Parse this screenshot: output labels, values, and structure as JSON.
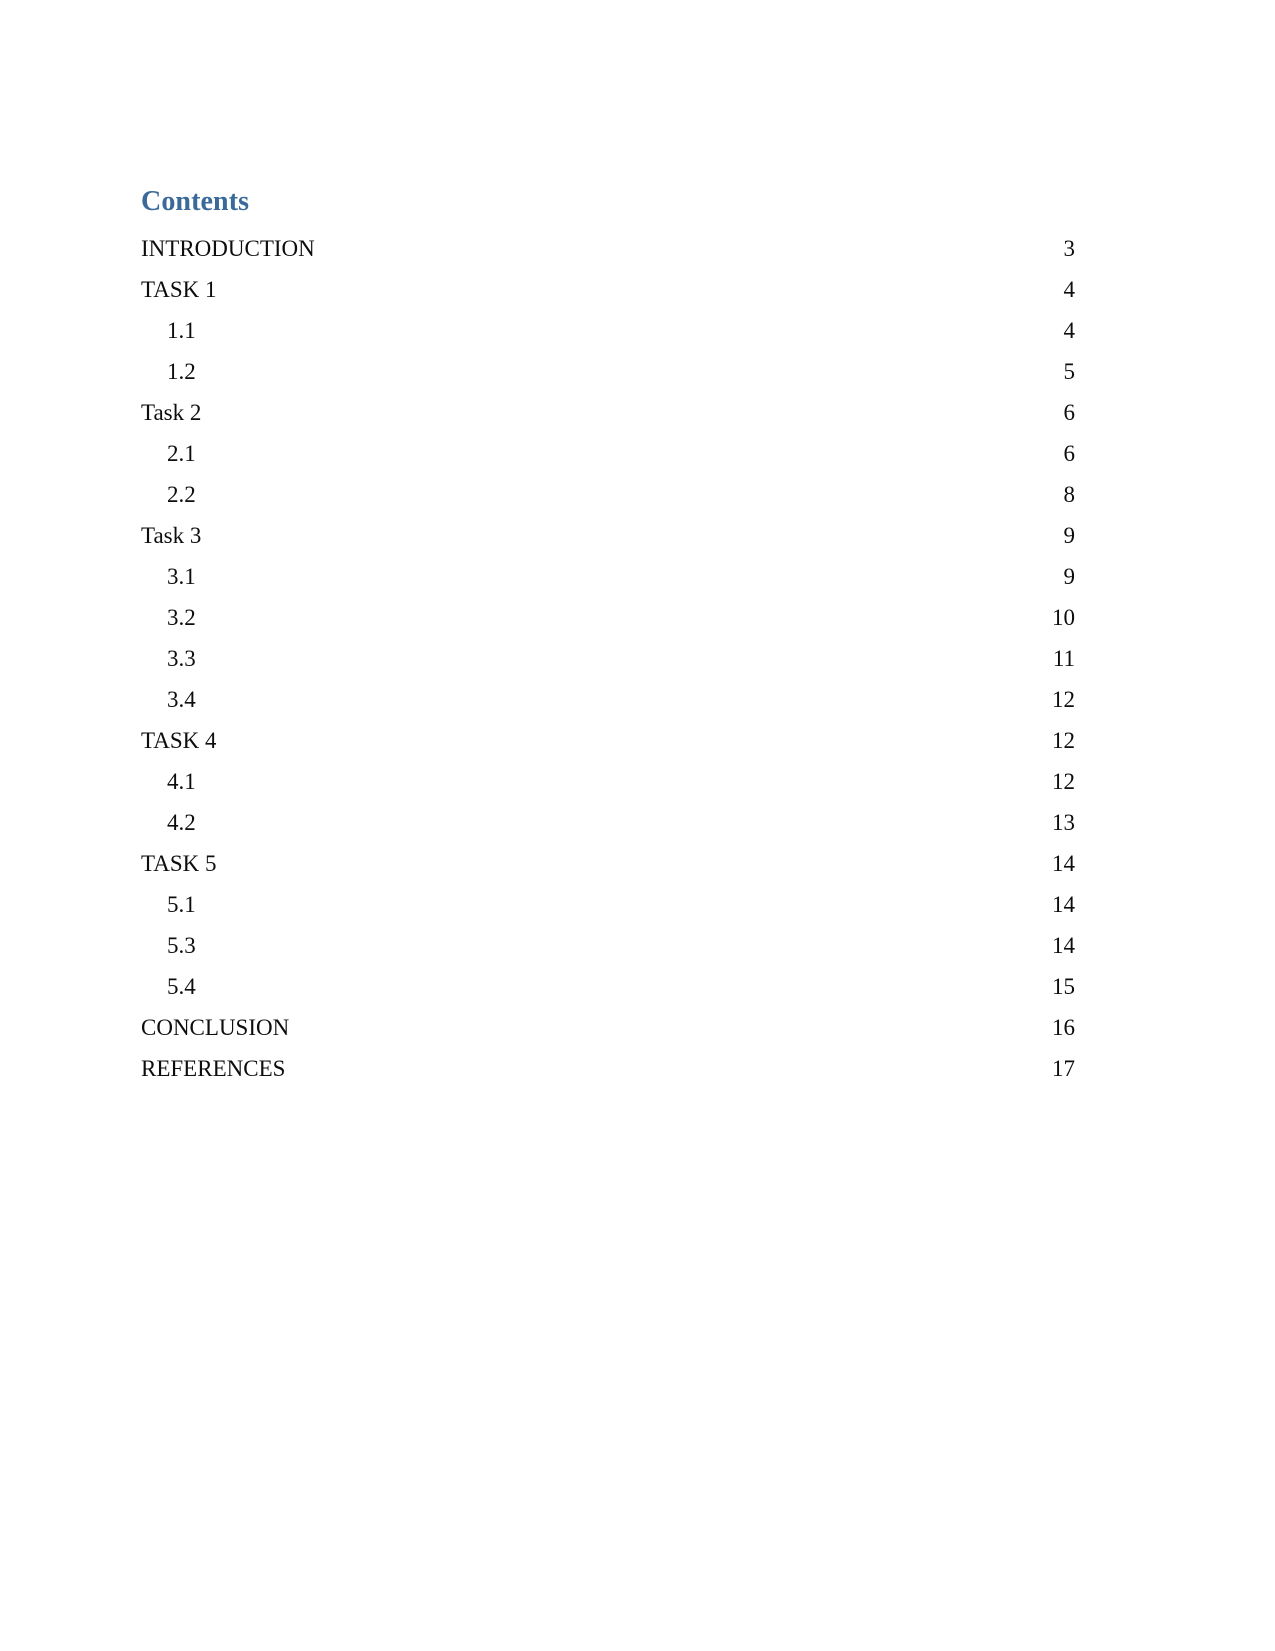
{
  "document": {
    "heading": "Contents",
    "heading_color": "#3A6A9A",
    "text_color": "#0d0d0d",
    "background_color": "#ffffff"
  },
  "toc": {
    "entries": [
      {
        "title": "INTRODUCTION",
        "page": "3",
        "level": 1
      },
      {
        "title": "TASK 1",
        "page": "4",
        "level": 1
      },
      {
        "title": "1.1",
        "page": "4",
        "level": 2
      },
      {
        "title": "1.2",
        "page": "5",
        "level": 2
      },
      {
        "title": "Task 2",
        "page": "6",
        "level": 1
      },
      {
        "title": "2.1",
        "page": "6",
        "level": 2
      },
      {
        "title": "2.2",
        "page": "8",
        "level": 2
      },
      {
        "title": "Task 3",
        "page": "9",
        "level": 1
      },
      {
        "title": "3.1",
        "page": "9",
        "level": 2
      },
      {
        "title": "3.2",
        "page": "10",
        "level": 2
      },
      {
        "title": "3.3",
        "page": "11",
        "level": 2
      },
      {
        "title": "3.4",
        "page": "12",
        "level": 2
      },
      {
        "title": "TASK 4",
        "page": "12",
        "level": 1
      },
      {
        "title": "4.1",
        "page": "12",
        "level": 2
      },
      {
        "title": "4.2",
        "page": "13",
        "level": 2
      },
      {
        "title": "TASK 5",
        "page": "14",
        "level": 1
      },
      {
        "title": "5.1",
        "page": "14",
        "level": 2
      },
      {
        "title": "5.3",
        "page": "14",
        "level": 2
      },
      {
        "title": "5.4",
        "page": "15",
        "level": 2
      },
      {
        "title": "CONCLUSION",
        "page": "16",
        "level": 1
      },
      {
        "title": "REFERENCES",
        "page": "17",
        "level": 1
      }
    ]
  }
}
